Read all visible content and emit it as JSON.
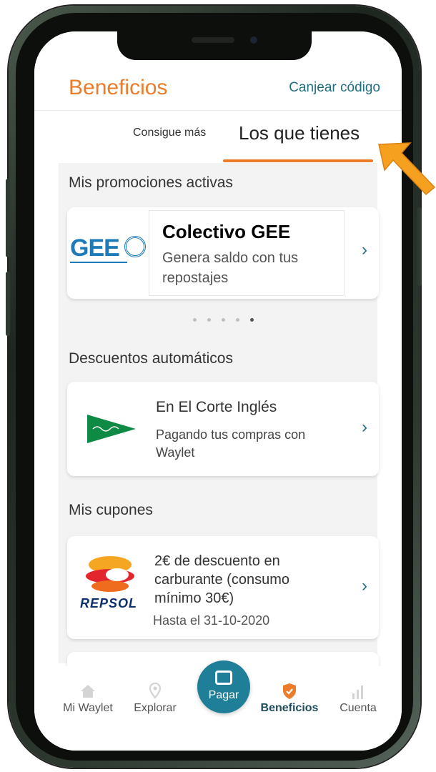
{
  "header": {
    "title": "Beneficios",
    "redeem_code": "Canjear código"
  },
  "tabs": {
    "get_more": "Consigue más",
    "owned": "Los que tienes"
  },
  "active_promotions": {
    "section_title": "Mis promociones activas",
    "card": {
      "logo": "GEE",
      "title": "Colectivo GEE",
      "description": "Genera saldo con tus repostajes"
    },
    "pager": {
      "count": 5,
      "active_index": 4
    }
  },
  "auto_discounts": {
    "section_title": "Descuentos automáticos",
    "card": {
      "title": "En El Corte Inglés",
      "description": "Pagando tus compras con Waylet"
    }
  },
  "coupons": {
    "section_title": "Mis cupones",
    "card": {
      "brand": "REPSOL",
      "title": "2€ de descuento en carburante (consumo mínimo 30€)",
      "expiry": "Hasta el 31-10-2020"
    }
  },
  "bottom_nav": {
    "items": [
      {
        "label": "Mi Waylet",
        "icon": "home-icon"
      },
      {
        "label": "Explorar",
        "icon": "location-pin-icon"
      },
      {
        "label": "Pagar",
        "icon": "pay-icon"
      },
      {
        "label": "Beneficios",
        "icon": "shield-icon",
        "active": true
      },
      {
        "label": "Cuenta",
        "icon": "signal-bars-icon"
      }
    ]
  },
  "colors": {
    "accent_orange": "#ec7b2a",
    "brand_teal": "#1f7f98",
    "link_teal": "#1e6e82"
  }
}
